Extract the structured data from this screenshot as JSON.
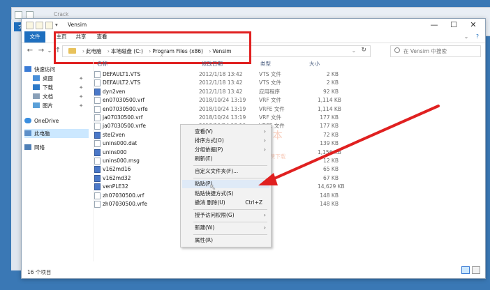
{
  "background_window": {
    "title": "Crack",
    "tab": "文"
  },
  "window": {
    "title": "Vensim",
    "min": "—",
    "max": "☐",
    "close": "✕",
    "help": "?"
  },
  "ribbon": {
    "tabs": [
      "文件",
      "主页",
      "共享",
      "查看"
    ]
  },
  "nav": {
    "back": "←",
    "forward": "→",
    "recent": "⌄",
    "up": "↑"
  },
  "address": {
    "crumbs": [
      "此电脑",
      "本地磁盘 (C:)",
      "Program Files (x86)",
      "Vensim"
    ],
    "separator": "›",
    "dropdown": "⌄",
    "refresh": "↻"
  },
  "search": {
    "placeholder": "在 Vensim 中搜索"
  },
  "sidebar": {
    "items": [
      {
        "label": "快速访问",
        "icon": "star-icon",
        "pinned": false
      },
      {
        "label": "桌面",
        "icon": "desktop-icon",
        "pinned": true
      },
      {
        "label": "下载",
        "icon": "download-icon",
        "pinned": true
      },
      {
        "label": "文档",
        "icon": "document-icon",
        "pinned": true
      },
      {
        "label": "图片",
        "icon": "picture-icon",
        "pinned": true
      },
      {
        "label": "OneDrive",
        "icon": "cloud-icon",
        "pinned": false
      },
      {
        "label": "此电脑",
        "icon": "computer-icon",
        "pinned": false,
        "selected": true
      },
      {
        "label": "网络",
        "icon": "network-icon",
        "pinned": false
      }
    ],
    "pin_glyph": "✦"
  },
  "columns": {
    "name": "名称",
    "date": "修改日期",
    "type": "类型",
    "size": "大小",
    "sort_glyph": "^"
  },
  "files": [
    {
      "name": "DEFAULT1.VTS",
      "date": "2012/1/18 13:42",
      "type": "VTS 文件",
      "size": "2 KB",
      "icon": "file-icon"
    },
    {
      "name": "DEFAULT2.VTS",
      "date": "2012/1/18 13:42",
      "type": "VTS 文件",
      "size": "2 KB",
      "icon": "file-icon"
    },
    {
      "name": "dyn2ven",
      "date": "2012/1/18 13:42",
      "type": "应用程序",
      "size": "92 KB",
      "icon": "app-icon"
    },
    {
      "name": "en07030500.vrf",
      "date": "2018/10/24 13:19",
      "type": "VRF 文件",
      "size": "1,114 KB",
      "icon": "file-icon"
    },
    {
      "name": "en07030500.vrfe",
      "date": "2018/10/24 13:19",
      "type": "VRFE 文件",
      "size": "1,114 KB",
      "icon": "file-icon"
    },
    {
      "name": "ja07030500.vrf",
      "date": "2018/10/24 13:19",
      "type": "VRF 文件",
      "size": "177 KB",
      "icon": "file-icon"
    },
    {
      "name": "ja07030500.vrfe",
      "date": "2018/10/24 13:19",
      "type": "VRFE 文件",
      "size": "177 KB",
      "icon": "file-icon"
    },
    {
      "name": "stel2ven",
      "date": "",
      "type": "",
      "size": "72 KB",
      "icon": "app-icon"
    },
    {
      "name": "unins000.dat",
      "date": "",
      "type": "",
      "size": "139 KB",
      "icon": "file-icon"
    },
    {
      "name": "unins000",
      "date": "",
      "type": "",
      "size": "1,156 KB",
      "icon": "app-icon"
    },
    {
      "name": "unins000.msg",
      "date": "",
      "type": "",
      "size": "12 KB",
      "icon": "file-icon"
    },
    {
      "name": "v162md16",
      "date": "",
      "type": "",
      "size": "65 KB",
      "icon": "app-icon"
    },
    {
      "name": "v162md32",
      "date": "",
      "type": "",
      "size": "67 KB",
      "icon": "app-icon"
    },
    {
      "name": "venPLE32",
      "date": "",
      "type": "",
      "size": "14,629 KB",
      "icon": "app-icon"
    },
    {
      "name": "zh07030500.vrf",
      "date": "",
      "type": "",
      "size": "148 KB",
      "icon": "file-icon"
    },
    {
      "name": "zh07030500.vrfe",
      "date": "",
      "type": "",
      "size": "148 KB",
      "icon": "file-icon"
    }
  ],
  "status": {
    "count": "16 个项目"
  },
  "context_menu": {
    "items": [
      {
        "label": "查看(V)",
        "arrow": "›"
      },
      {
        "label": "排序方式(O)",
        "arrow": "›"
      },
      {
        "label": "分组依据(P)",
        "arrow": "›"
      },
      {
        "label": "刷新(E)"
      },
      {
        "label": "自定义文件夹(F)..."
      },
      {
        "label": "粘贴(P)"
      },
      {
        "label": "粘贴快捷方式(S)"
      },
      {
        "label": "撤消 删除(U)",
        "shortcut": "Ctrl+Z"
      },
      {
        "label": "授予访问权限(G)",
        "arrow": "›"
      },
      {
        "label": "新建(W)",
        "arrow": "›"
      },
      {
        "label": "属性(R)"
      }
    ]
  },
  "watermark": {
    "line1": "学 工 同 学 自 学 本",
    "line2": "www.ts98.com",
    "line3": "软件 · 教程 · 资料网盘直链免费下载"
  },
  "cursor_glyph": "↖",
  "colors": {
    "accent": "#1e6fbf",
    "annotation_red": "#e02020",
    "desktop": "#3a78b5",
    "selection": "#cce8ff"
  }
}
